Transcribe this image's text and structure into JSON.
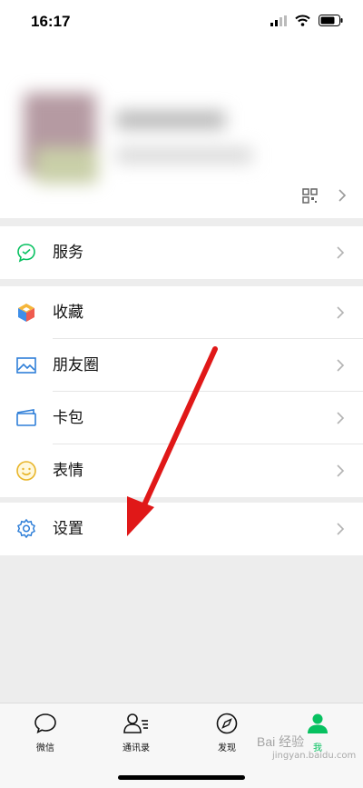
{
  "status_bar": {
    "time": "16:17"
  },
  "profile": {
    "qr_icon": "qr-code-icon",
    "chevron": "chevron-right-icon"
  },
  "groups": [
    {
      "items": [
        {
          "label": "服务",
          "icon": "wechat-pay-icon"
        }
      ]
    },
    {
      "items": [
        {
          "label": "收藏",
          "icon": "cube-icon"
        },
        {
          "label": "朋友圈",
          "icon": "image-icon"
        },
        {
          "label": "卡包",
          "icon": "wallet-icon"
        },
        {
          "label": "表情",
          "icon": "smiley-icon"
        }
      ]
    },
    {
      "items": [
        {
          "label": "设置",
          "icon": "gear-icon"
        }
      ]
    }
  ],
  "tabbar": {
    "tabs": [
      {
        "label": "微信",
        "icon": "chat-bubble-icon"
      },
      {
        "label": "通讯录",
        "icon": "contacts-icon"
      },
      {
        "label": "发现",
        "icon": "compass-icon"
      },
      {
        "label": "我",
        "icon": "person-icon",
        "active": true
      }
    ]
  },
  "watermark": {
    "text": "Bai 经验",
    "sub": "jingyan.baidu.com"
  },
  "colors": {
    "accent": "#07c160",
    "arrow": "#e01818",
    "background": "#ededed"
  }
}
